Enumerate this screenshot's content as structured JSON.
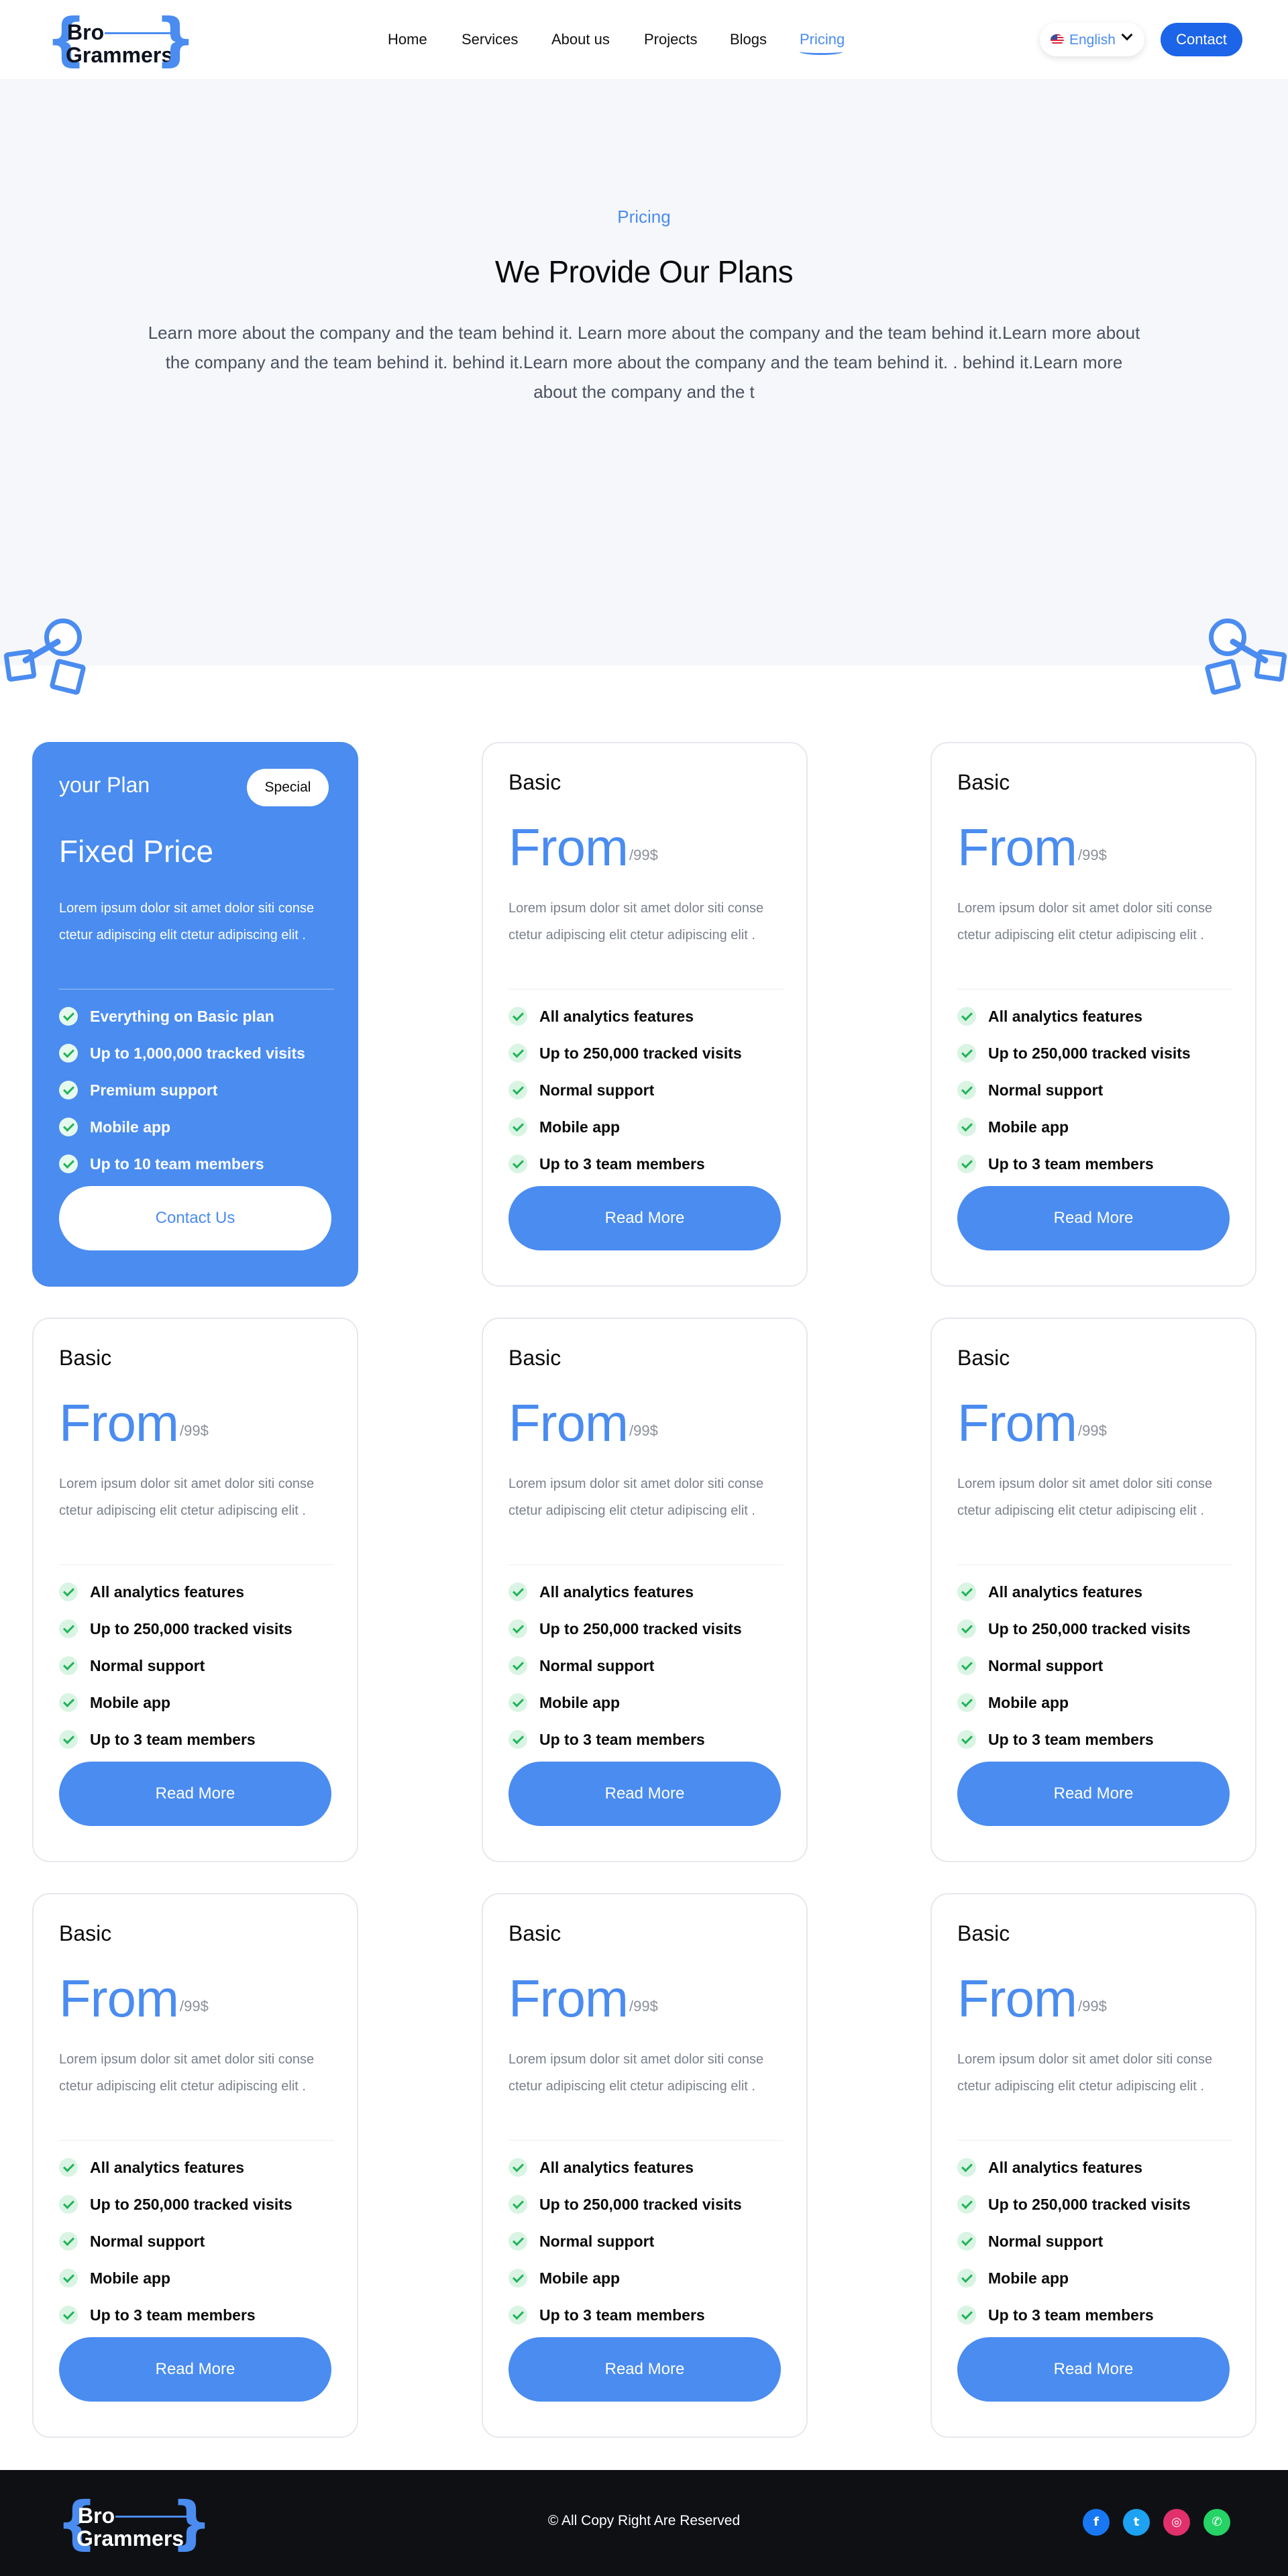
{
  "nav": {
    "logo": {
      "line1": "Bro",
      "line2": "Grammers"
    },
    "links": [
      "Home",
      "Services",
      "About us",
      "Projects",
      "Blogs",
      "Pricing"
    ],
    "active": "Pricing",
    "language": "English",
    "contact_label": "Contact"
  },
  "hero": {
    "tag": "Pricing",
    "title": "We Provide Our Plans",
    "text": "Learn more about the company and the team behind it. Learn more about the company and the team behind it.Learn more about the company and the team behind it. behind it.Learn more about the company and the team behind it. . behind it.Learn more about the company and the t"
  },
  "featured_plan": {
    "name": "your Plan",
    "badge": "Special",
    "price": "Fixed Price",
    "desc": "Lorem ipsum dolor sit amet dolor siti conse ctetur adipiscing elit ctetur adipiscing elit .",
    "features": [
      "Everything on Basic plan",
      "Up to 1,000,000 tracked visits",
      "Premium support",
      "Mobile app",
      "Up to 10 team members"
    ],
    "button": "Contact Us"
  },
  "basic_plan": {
    "name": "Basic",
    "price": "From",
    "per": "/99$",
    "desc": "Lorem ipsum dolor sit amet dolor siti conse ctetur adipiscing elit ctetur adipiscing elit .",
    "features": [
      "All analytics features",
      "Up to 250,000 tracked visits",
      "Normal support",
      "Mobile app",
      "Up to 3 team members"
    ],
    "button": "Read More"
  },
  "footer": {
    "logo": {
      "line1": "Bro",
      "line2": "Grammers"
    },
    "copyright": "© All Copy Right Are Reserved",
    "social": [
      "facebook-icon",
      "twitter-icon",
      "instagram-icon",
      "whatsapp-icon"
    ]
  },
  "colors": {
    "accent": "#4a8cf0",
    "button": "#1c64e8",
    "footer": "#0f1014",
    "hero_bg": "#f6f7fb"
  }
}
